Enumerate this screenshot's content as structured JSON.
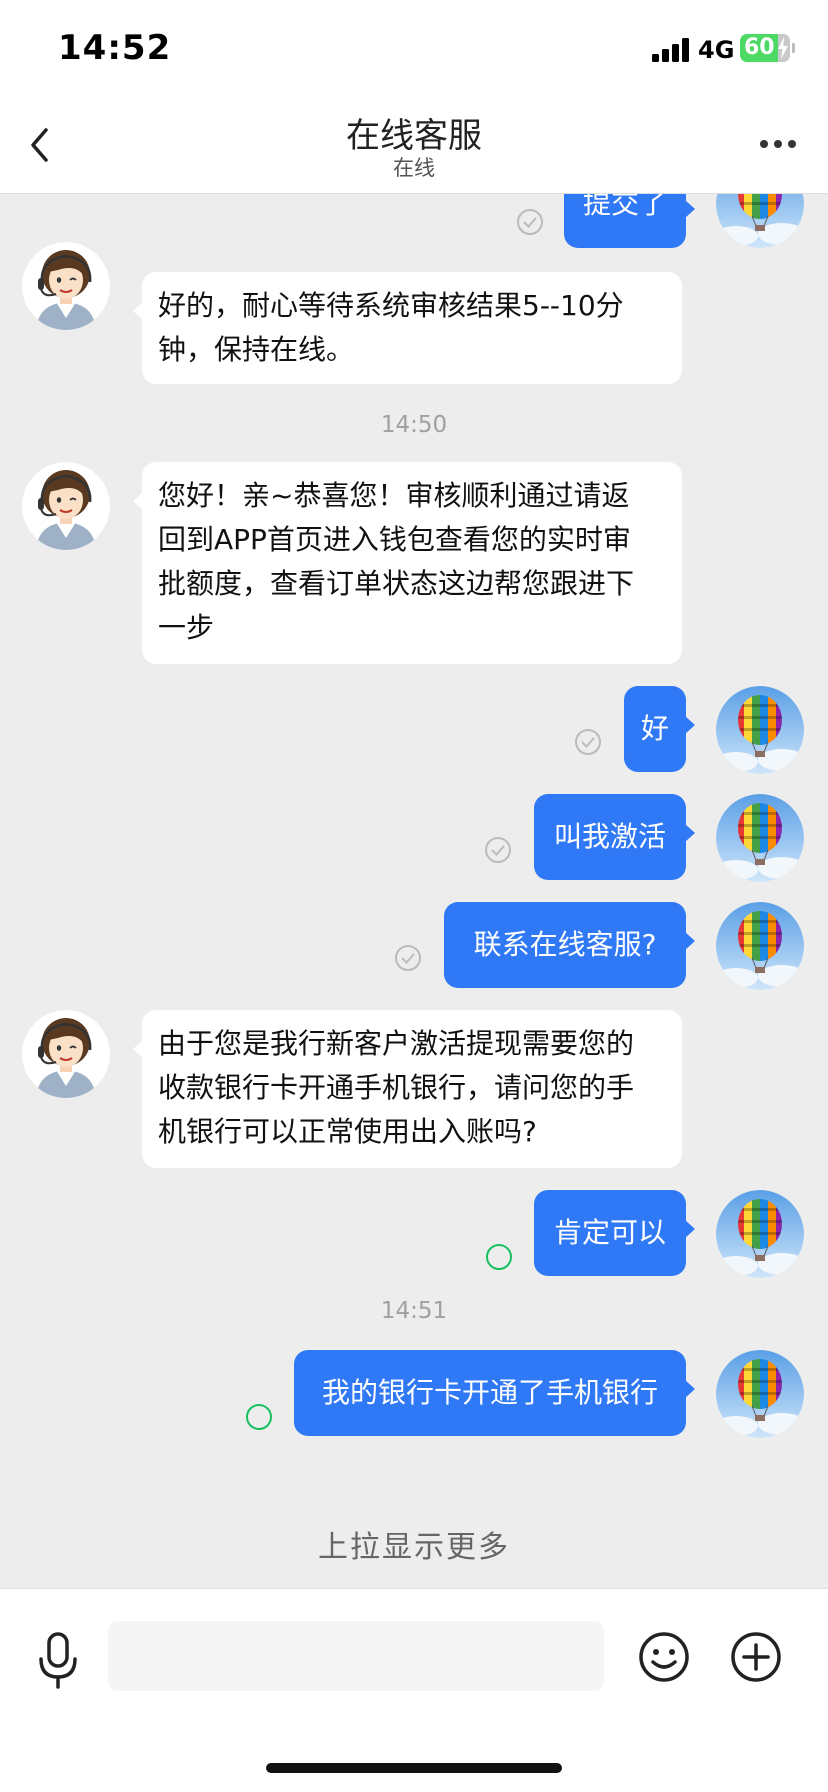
{
  "status_bar": {
    "time": "14:52",
    "network": "4G",
    "battery": "60"
  },
  "nav": {
    "title": "在线客服",
    "subtitle": "在线",
    "back_icon": "chevron-left-icon",
    "more_icon": "more-dots-icon"
  },
  "messages": [
    {
      "from": "user",
      "text": "提交了",
      "status": "read"
    },
    {
      "from": "agent",
      "lines": [
        "好的，耐心等待系统审核结果5--10分",
        "钟，保持在线。"
      ]
    },
    {
      "type": "time",
      "text": "14:50"
    },
    {
      "from": "agent",
      "lines": [
        "您好！亲~恭喜您！审核顺利通过请返",
        "回到APP首页进入钱包查看您的实时审",
        "批额度，查看订单状态这边帮您跟进下",
        "一步"
      ]
    },
    {
      "from": "user",
      "text": "好",
      "status": "read"
    },
    {
      "from": "user",
      "text": "叫我激活",
      "status": "read"
    },
    {
      "from": "user",
      "text": "联系在线客服?",
      "status": "read"
    },
    {
      "from": "agent",
      "lines": [
        "由于您是我行新客户激活提现需要您的",
        "收款银行卡开通手机银行，请问您的手",
        "机银行可以正常使用出入账吗?"
      ]
    },
    {
      "from": "user",
      "text": "肯定可以",
      "status": "pending"
    },
    {
      "type": "time",
      "text": "14:51"
    },
    {
      "from": "user",
      "text": "我的银行卡开通了手机银行",
      "status": "pending"
    }
  ],
  "load_more": "上拉显示更多",
  "input_bar": {
    "voice_icon": "microphone-icon",
    "placeholder": "",
    "emoji_icon": "smiley-icon",
    "plus_icon": "plus-circle-icon"
  },
  "colors": {
    "outgoing_bubble": "#2f78f6",
    "incoming_bubble": "#ffffff",
    "background": "#ededed",
    "pending_ring": "#19c061"
  }
}
